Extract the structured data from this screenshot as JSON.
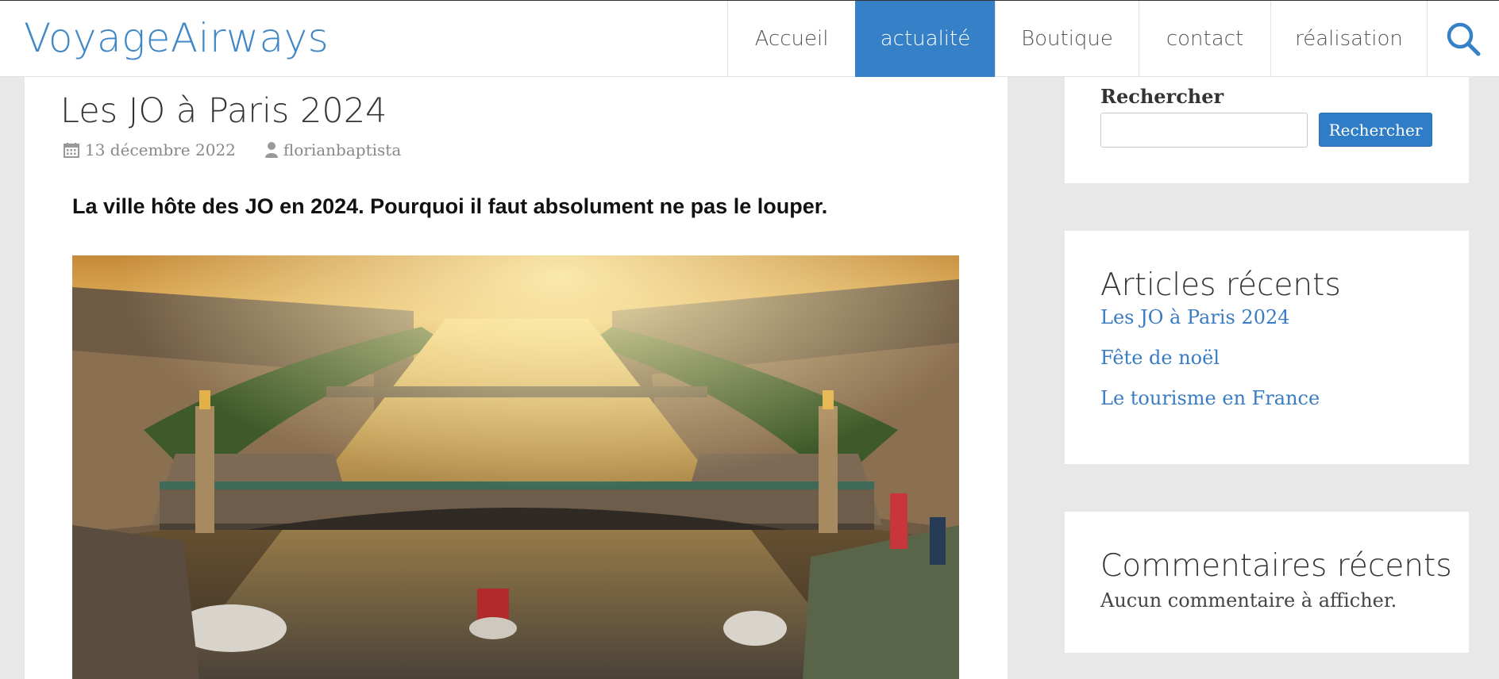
{
  "site": {
    "logo": "VoyageAirways"
  },
  "nav": {
    "items": [
      "Accueil",
      "actualité",
      "Boutique",
      "contact",
      "réalisation"
    ],
    "active": "actualité"
  },
  "post": {
    "title": "Les JO à Paris 2024",
    "date": "13 décembre 2022",
    "author": "florianbaptista",
    "subtitle": "La ville hôte des JO en 2024. Pourquoi il faut absolument ne pas le louper."
  },
  "sidebar": {
    "search": {
      "label": "Rechercher",
      "value": "",
      "button": "Rechercher"
    },
    "recent_posts": {
      "title": "Articles récents",
      "items": [
        "Les JO à Paris 2024",
        "Fête de noël",
        "Le tourisme en France"
      ]
    },
    "recent_comments": {
      "title": "Commentaires récents",
      "empty": "Aucun commentaire à afficher."
    }
  },
  "colors": {
    "accent": "#3580c6",
    "link": "#3a7cc2",
    "background": "#e8e8e8"
  }
}
